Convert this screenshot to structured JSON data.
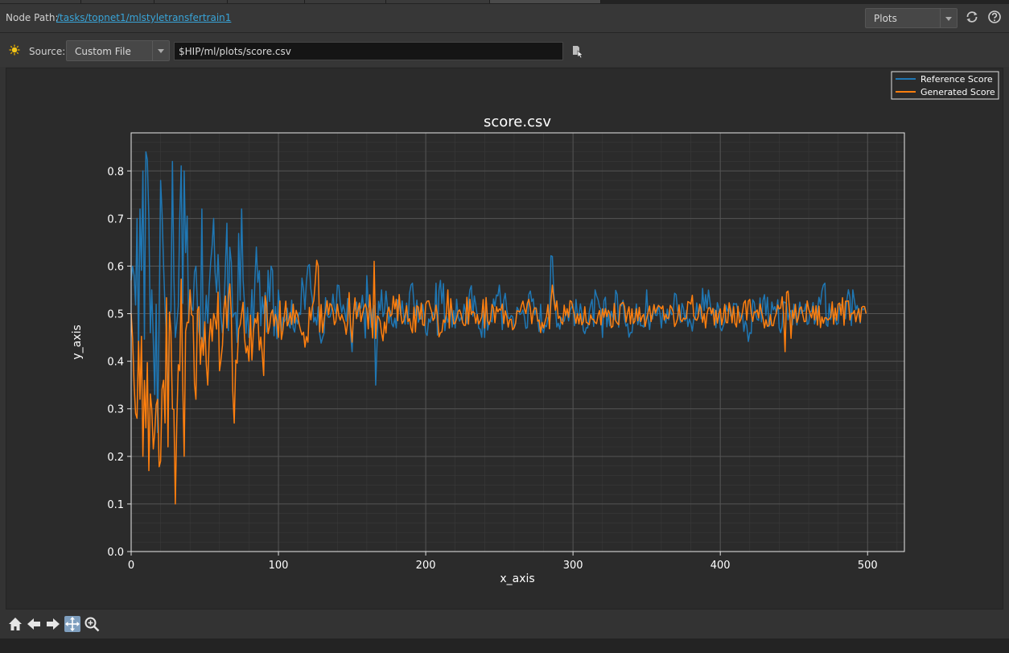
{
  "header": {
    "node_path_label": "Node Path:",
    "node_path_value": "/tasks/topnet1/mlstyletransfertrain1",
    "view_dropdown": "Plots"
  },
  "source": {
    "label": "Source:",
    "type": "Custom File",
    "path": "$HIP/ml/plots/score.csv"
  },
  "colors": {
    "reference": "#1f77b4",
    "generated": "#ff7f0e",
    "link": "#38a4d8"
  },
  "icons": [
    "refresh-icon",
    "help-icon",
    "sun-icon",
    "file-browse-icon",
    "home-icon",
    "back-arrow-icon",
    "forward-arrow-icon",
    "pan-icon",
    "zoom-icon"
  ],
  "chart_data": {
    "type": "line",
    "title": "score.csv",
    "xlabel": "x_axis",
    "ylabel": "y_axis",
    "xlim": [
      0,
      525
    ],
    "ylim": [
      0,
      0.88
    ],
    "xticks": [
      0,
      100,
      200,
      300,
      400,
      500
    ],
    "yticks": [
      0.0,
      0.1,
      0.2,
      0.3,
      0.4,
      0.5,
      0.6,
      0.7,
      0.8
    ],
    "grid": true,
    "legend": "top-right",
    "series": [
      {
        "name": "Reference Score",
        "x_range": [
          0,
          499
        ],
        "samples": [
          [
            0,
            0.57
          ],
          [
            2,
            0.58
          ],
          [
            4,
            0.7
          ],
          [
            6,
            0.72
          ],
          [
            8,
            0.8
          ],
          [
            10,
            0.84
          ],
          [
            12,
            0.7
          ],
          [
            14,
            0.55
          ],
          [
            16,
            0.33
          ],
          [
            18,
            0.25
          ],
          [
            20,
            0.78
          ],
          [
            22,
            0.6
          ],
          [
            25,
            0.3
          ],
          [
            28,
            0.82
          ],
          [
            30,
            0.45
          ],
          [
            33,
            0.7
          ],
          [
            36,
            0.8
          ],
          [
            40,
            0.55
          ],
          [
            44,
            0.6
          ],
          [
            48,
            0.72
          ],
          [
            52,
            0.48
          ],
          [
            56,
            0.7
          ],
          [
            60,
            0.55
          ],
          [
            65,
            0.69
          ],
          [
            70,
            0.5
          ],
          [
            75,
            0.72
          ],
          [
            80,
            0.45
          ],
          [
            85,
            0.64
          ],
          [
            90,
            0.5
          ],
          [
            95,
            0.6
          ],
          [
            100,
            0.55
          ],
          [
            110,
            0.47
          ],
          [
            120,
            0.6
          ],
          [
            130,
            0.45
          ],
          [
            140,
            0.56
          ],
          [
            150,
            0.42
          ],
          [
            160,
            0.58
          ],
          [
            166,
            0.35
          ],
          [
            170,
            0.55
          ],
          [
            180,
            0.47
          ],
          [
            190,
            0.56
          ],
          [
            200,
            0.46
          ],
          [
            210,
            0.57
          ],
          [
            220,
            0.47
          ],
          [
            230,
            0.55
          ],
          [
            240,
            0.45
          ],
          [
            250,
            0.56
          ],
          [
            260,
            0.47
          ],
          [
            270,
            0.54
          ],
          [
            280,
            0.46
          ],
          [
            286,
            0.62
          ],
          [
            290,
            0.48
          ],
          [
            300,
            0.52
          ],
          [
            310,
            0.47
          ],
          [
            315,
            0.55
          ],
          [
            320,
            0.45
          ],
          [
            330,
            0.54
          ],
          [
            340,
            0.46
          ],
          [
            350,
            0.55
          ],
          [
            360,
            0.47
          ],
          [
            370,
            0.54
          ],
          [
            380,
            0.48
          ],
          [
            390,
            0.54
          ],
          [
            400,
            0.47
          ],
          [
            410,
            0.52
          ],
          [
            420,
            0.46
          ],
          [
            430,
            0.54
          ],
          [
            440,
            0.47
          ],
          [
            450,
            0.52
          ],
          [
            460,
            0.48
          ],
          [
            470,
            0.56
          ],
          [
            480,
            0.48
          ],
          [
            490,
            0.55
          ],
          [
            495,
            0.48
          ],
          [
            499,
            0.5
          ]
        ]
      },
      {
        "name": "Generated Score",
        "x_range": [
          0,
          499
        ],
        "samples": [
          [
            0,
            0.5
          ],
          [
            2,
            0.35
          ],
          [
            4,
            0.28
          ],
          [
            6,
            0.32
          ],
          [
            8,
            0.2
          ],
          [
            10,
            0.26
          ],
          [
            12,
            0.17
          ],
          [
            14,
            0.3
          ],
          [
            16,
            0.25
          ],
          [
            18,
            0.32
          ],
          [
            20,
            0.19
          ],
          [
            22,
            0.36
          ],
          [
            25,
            0.22
          ],
          [
            28,
            0.3
          ],
          [
            30,
            0.1
          ],
          [
            33,
            0.38
          ],
          [
            36,
            0.2
          ],
          [
            40,
            0.55
          ],
          [
            44,
            0.32
          ],
          [
            48,
            0.45
          ],
          [
            52,
            0.35
          ],
          [
            56,
            0.5
          ],
          [
            60,
            0.38
          ],
          [
            65,
            0.47
          ],
          [
            70,
            0.27
          ],
          [
            75,
            0.5
          ],
          [
            80,
            0.4
          ],
          [
            85,
            0.48
          ],
          [
            90,
            0.37
          ],
          [
            95,
            0.5
          ],
          [
            100,
            0.45
          ],
          [
            110,
            0.52
          ],
          [
            120,
            0.44
          ],
          [
            127,
            0.6
          ],
          [
            130,
            0.46
          ],
          [
            140,
            0.52
          ],
          [
            150,
            0.44
          ],
          [
            160,
            0.51
          ],
          [
            165,
            0.61
          ],
          [
            170,
            0.46
          ],
          [
            180,
            0.53
          ],
          [
            190,
            0.47
          ],
          [
            200,
            0.52
          ],
          [
            210,
            0.46
          ],
          [
            215,
            0.55
          ],
          [
            220,
            0.48
          ],
          [
            230,
            0.53
          ],
          [
            240,
            0.47
          ],
          [
            250,
            0.51
          ],
          [
            260,
            0.47
          ],
          [
            270,
            0.53
          ],
          [
            280,
            0.47
          ],
          [
            286,
            0.56
          ],
          [
            290,
            0.49
          ],
          [
            300,
            0.51
          ],
          [
            310,
            0.48
          ],
          [
            320,
            0.51
          ],
          [
            330,
            0.48
          ],
          [
            340,
            0.51
          ],
          [
            350,
            0.49
          ],
          [
            360,
            0.51
          ],
          [
            370,
            0.48
          ],
          [
            380,
            0.52
          ],
          [
            390,
            0.47
          ],
          [
            400,
            0.51
          ],
          [
            410,
            0.48
          ],
          [
            420,
            0.53
          ],
          [
            430,
            0.47
          ],
          [
            440,
            0.51
          ],
          [
            444,
            0.42
          ],
          [
            450,
            0.49
          ],
          [
            460,
            0.51
          ],
          [
            470,
            0.48
          ],
          [
            480,
            0.52
          ],
          [
            490,
            0.5
          ],
          [
            499,
            0.5
          ]
        ]
      }
    ]
  }
}
